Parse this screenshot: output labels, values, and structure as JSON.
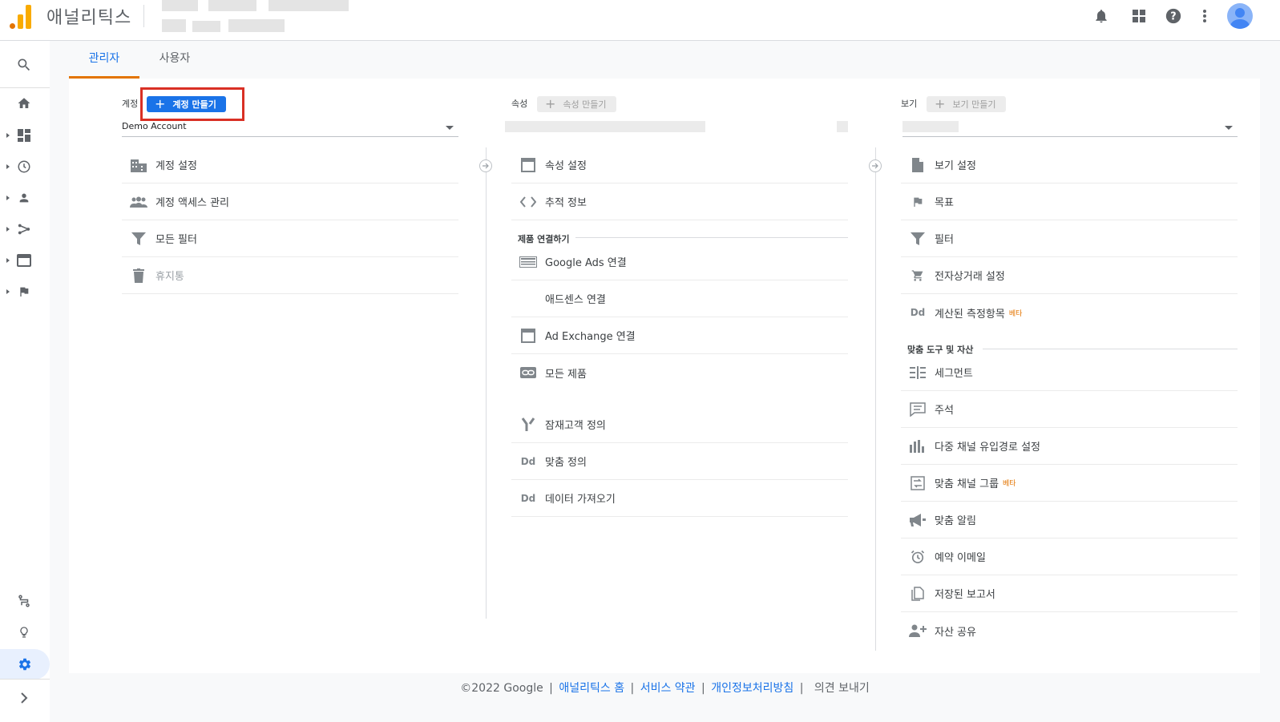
{
  "header": {
    "app_title": "애널리틱스"
  },
  "tabs": [
    {
      "label": "관리자",
      "active": true
    },
    {
      "label": "사용자",
      "active": false
    }
  ],
  "account_column": {
    "label": "계정",
    "create_button": "계정 만들기",
    "selected": "Demo Account",
    "items": [
      {
        "icon": "building-icon",
        "label": "계정 설정"
      },
      {
        "icon": "people-icon",
        "label": "계정 액세스 관리"
      },
      {
        "icon": "filter-icon",
        "label": "모든 필터"
      },
      {
        "icon": "trash-icon",
        "label": "휴지통",
        "disabled": true
      }
    ]
  },
  "property_column": {
    "label": "속성",
    "create_button": "속성 만들기",
    "items": [
      {
        "icon": "window-icon",
        "label": "속성 설정"
      },
      {
        "icon": "code-icon",
        "label": "추적 정보"
      }
    ],
    "section_title": "제품 연결하기",
    "product_items": [
      {
        "icon": "ads-icon",
        "label": "Google Ads 연결"
      },
      {
        "icon": "",
        "label": "애드센스 연결"
      },
      {
        "icon": "window-icon",
        "label": "Ad Exchange 연결"
      },
      {
        "icon": "link-icon",
        "label": "모든 제품"
      }
    ],
    "bottom_items": [
      {
        "icon": "fork-icon",
        "label": "잠재고객 정의"
      },
      {
        "icon": "dd-icon",
        "label": "맞춤 정의"
      },
      {
        "icon": "dd-icon",
        "label": "데이터 가져오기"
      }
    ]
  },
  "view_column": {
    "label": "보기",
    "create_button": "보기 만들기",
    "items": [
      {
        "icon": "file-icon",
        "label": "보기 설정"
      },
      {
        "icon": "flag-icon",
        "label": "목표"
      },
      {
        "icon": "filter-icon",
        "label": "필터"
      },
      {
        "icon": "cart-icon",
        "label": "전자상거래 설정"
      },
      {
        "icon": "dd-icon",
        "label": "계산된 측정항목",
        "beta": "베타"
      }
    ],
    "section_title": "맞춤 도구 및 자산",
    "tool_items": [
      {
        "icon": "segment-icon",
        "label": "세그먼트"
      },
      {
        "icon": "comment-icon",
        "label": "주석"
      },
      {
        "icon": "bar-chart-icon",
        "label": "다중 채널 유입경로 설정"
      },
      {
        "icon": "channel-group-icon",
        "label": "맞춤 채널 그룹",
        "beta": "베타"
      },
      {
        "icon": "megaphone-icon",
        "label": "맞춤 알림"
      },
      {
        "icon": "alarm-icon",
        "label": "예약 이메일"
      },
      {
        "icon": "copy-icon",
        "label": "저장된 보고서"
      },
      {
        "icon": "person-add-icon",
        "label": "자산 공유"
      }
    ]
  },
  "dd_label": "Dd",
  "footer": {
    "copyright": "©2022 Google",
    "links": [
      "애널리틱스 홈",
      "서비스 약관",
      "개인정보처리방침"
    ],
    "feedback": "의견 보내기"
  },
  "colors": {
    "accent": "#1a73e8",
    "tab_indicator": "#e37400",
    "highlight": "#d93025"
  }
}
